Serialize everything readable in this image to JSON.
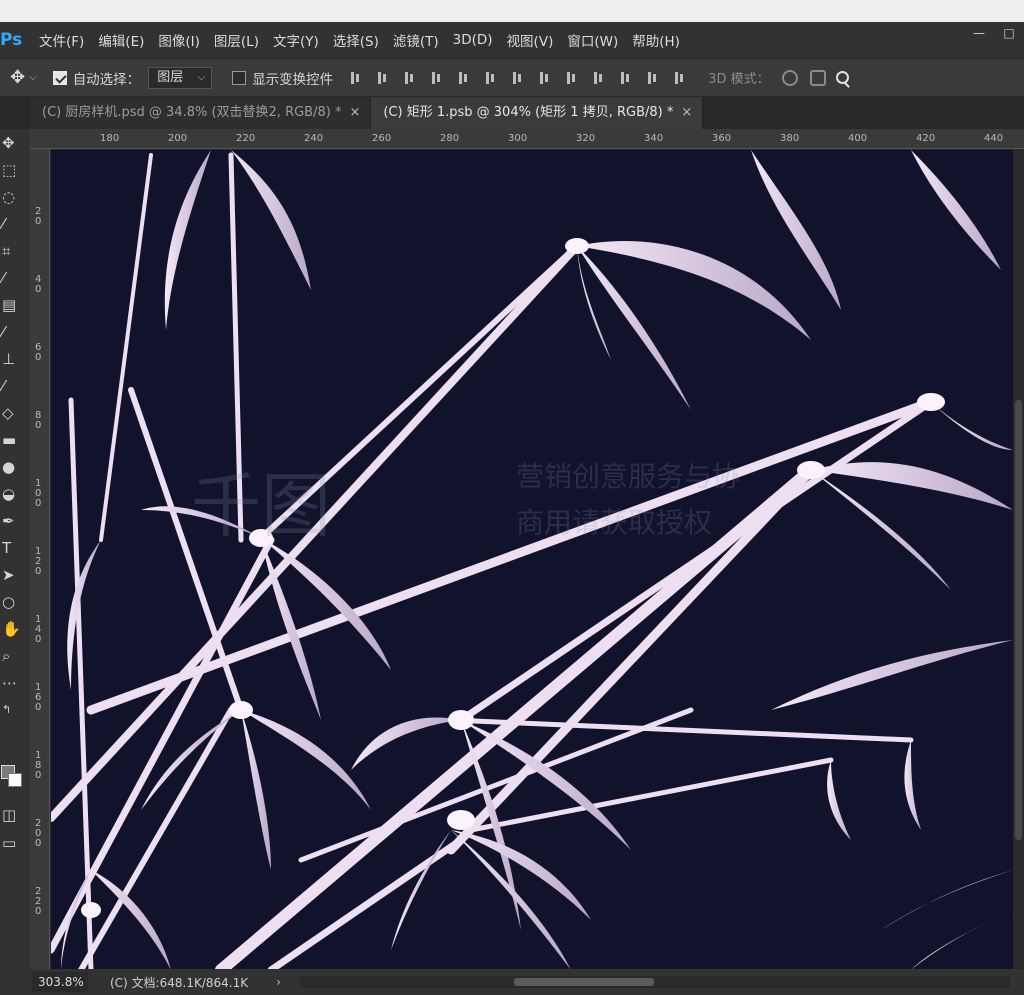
{
  "app": {
    "logo": "Ps"
  },
  "menu": [
    "文件(F)",
    "编辑(E)",
    "图像(I)",
    "图层(L)",
    "文字(Y)",
    "选择(S)",
    "滤镜(T)",
    "3D(D)",
    "视图(V)",
    "窗口(W)",
    "帮助(H)"
  ],
  "window_controls": {
    "minimize": "—",
    "maximize": "□"
  },
  "options": {
    "auto_select_label": "自动选择：",
    "auto_select_checked": true,
    "target_value": "图层",
    "show_transform_label": "显示变换控件",
    "show_transform_checked": false,
    "mode_3d_label": "3D 模式："
  },
  "tabs": [
    {
      "label": "(C) 厨房样机.psd @ 34.8% (双击替换2, RGB/8) *",
      "active": false
    },
    {
      "label": "(C) 矩形 1.psb @ 304% (矩形 1 拷贝, RGB/8) *",
      "active": true
    }
  ],
  "ruler": {
    "h_ticks": [
      "180",
      "200",
      "220",
      "240",
      "260",
      "280",
      "300",
      "320",
      "340",
      "360",
      "380",
      "400",
      "420",
      "440"
    ],
    "v_ticks": [
      "20",
      "40",
      "60",
      "80",
      "100",
      "120",
      "140",
      "160",
      "180",
      "200",
      "220"
    ]
  },
  "canvas": {
    "background": "#11122b",
    "stroke": "#f0e4f0"
  },
  "watermark": {
    "line1": "营销创意服务与协",
    "line2": "商用请获取授权",
    "logo": "千图"
  },
  "status": {
    "zoom": "303.8%",
    "doc": "(C) 文档:648.1K/864.1K",
    "arrow": "›"
  }
}
